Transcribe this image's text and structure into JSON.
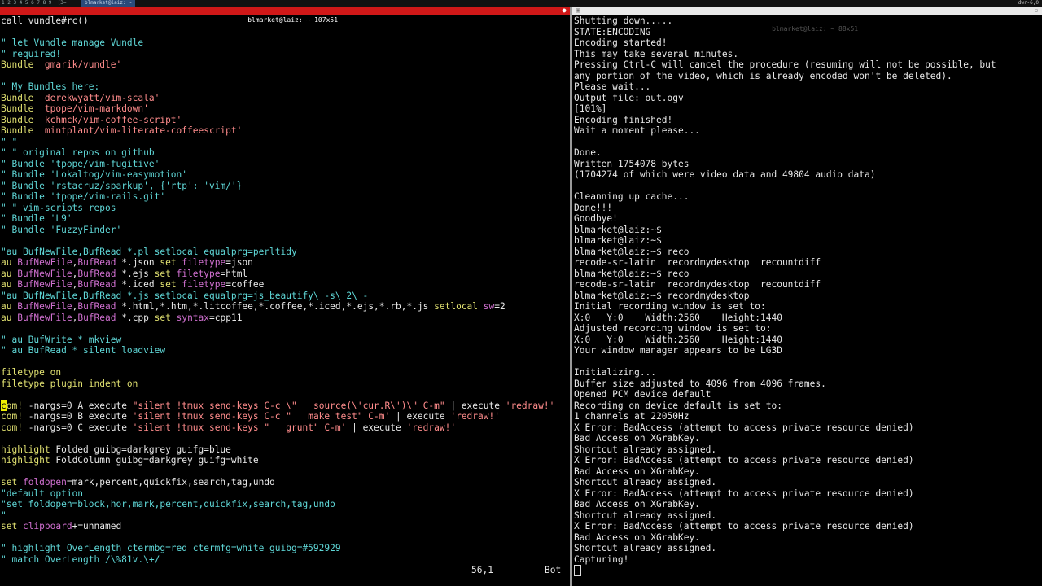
{
  "topbar": {
    "workspaces": "1 2 3 4 5 6 7 8 9  [3=",
    "task": "blmarket@laiz: ~",
    "clock": "dwr-6,0"
  },
  "vim_pane": {
    "title": "blmarket@laiz: ~ 107x51",
    "lines": [
      [
        [
          "w",
          "call vundle#rc()"
        ]
      ],
      [
        [
          "w",
          ""
        ]
      ],
      [
        [
          "c",
          "\" let Vundle manage Vundle"
        ]
      ],
      [
        [
          "c",
          "\" required!"
        ]
      ],
      [
        [
          "y",
          "Bundle "
        ],
        [
          "s",
          "'gmarik/vundle'"
        ]
      ],
      [
        [
          "w",
          ""
        ]
      ],
      [
        [
          "c",
          "\" My Bundles here:"
        ]
      ],
      [
        [
          "y",
          "Bundle "
        ],
        [
          "s",
          "'derekwyatt/vim-scala'"
        ]
      ],
      [
        [
          "y",
          "Bundle "
        ],
        [
          "s",
          "'tpope/vim-markdown'"
        ]
      ],
      [
        [
          "y",
          "Bundle "
        ],
        [
          "s",
          "'kchmck/vim-coffee-script'"
        ]
      ],
      [
        [
          "y",
          "Bundle "
        ],
        [
          "s",
          "'mintplant/vim-literate-coffeescript'"
        ]
      ],
      [
        [
          "c",
          "\" \""
        ]
      ],
      [
        [
          "c",
          "\" \" original repos on github"
        ]
      ],
      [
        [
          "c",
          "\" Bundle 'tpope/vim-fugitive'"
        ]
      ],
      [
        [
          "c",
          "\" Bundle 'Lokaltog/vim-easymotion'"
        ]
      ],
      [
        [
          "c",
          "\" Bundle 'rstacruz/sparkup', {'rtp': 'vim/'}"
        ]
      ],
      [
        [
          "c",
          "\" Bundle 'tpope/vim-rails.git'"
        ]
      ],
      [
        [
          "c",
          "\" \" vim-scripts repos"
        ]
      ],
      [
        [
          "c",
          "\" Bundle 'L9'"
        ]
      ],
      [
        [
          "c",
          "\" Bundle 'FuzzyFinder'"
        ]
      ],
      [
        [
          "w",
          ""
        ]
      ],
      [
        [
          "c",
          "\"au BufNewFile,BufRead *.pl setlocal equalprg=perltidy"
        ]
      ],
      [
        [
          "y",
          "au "
        ],
        [
          "m",
          "BufNewFile"
        ],
        [
          "w",
          ","
        ],
        [
          "m",
          "BufRead "
        ],
        [
          "w",
          "*.json "
        ],
        [
          "y",
          "set "
        ],
        [
          "m",
          "filetype"
        ],
        [
          "w",
          "=json"
        ]
      ],
      [
        [
          "y",
          "au "
        ],
        [
          "m",
          "BufNewFile"
        ],
        [
          "w",
          ","
        ],
        [
          "m",
          "BufRead "
        ],
        [
          "w",
          "*.ejs "
        ],
        [
          "y",
          "set "
        ],
        [
          "m",
          "filetype"
        ],
        [
          "w",
          "=html"
        ]
      ],
      [
        [
          "y",
          "au "
        ],
        [
          "m",
          "BufNewFile"
        ],
        [
          "w",
          ","
        ],
        [
          "m",
          "BufRead "
        ],
        [
          "w",
          "*.iced "
        ],
        [
          "y",
          "set "
        ],
        [
          "m",
          "filetype"
        ],
        [
          "w",
          "=coffee"
        ]
      ],
      [
        [
          "c",
          "\"au BufNewFile,BufRead *.js setlocal equalprg=js_beautify\\ -s\\ 2\\ -"
        ]
      ],
      [
        [
          "y",
          "au "
        ],
        [
          "m",
          "BufNewFile"
        ],
        [
          "w",
          ","
        ],
        [
          "m",
          "BufRead "
        ],
        [
          "w",
          "*.html,*.htm,*.litcoffee,*.coffee,*.iced,*.ejs,*.rb,*.js "
        ],
        [
          "y",
          "setlocal "
        ],
        [
          "m",
          "sw"
        ],
        [
          "w",
          "=2"
        ]
      ],
      [
        [
          "y",
          "au "
        ],
        [
          "m",
          "BufNewFile"
        ],
        [
          "w",
          ","
        ],
        [
          "m",
          "BufRead "
        ],
        [
          "w",
          "*.cpp "
        ],
        [
          "y",
          "set "
        ],
        [
          "m",
          "syntax"
        ],
        [
          "w",
          "=cpp11"
        ]
      ],
      [
        [
          "w",
          ""
        ]
      ],
      [
        [
          "c",
          "\" au BufWrite * mkview"
        ]
      ],
      [
        [
          "c",
          "\" au BufRead * silent loadview"
        ]
      ],
      [
        [
          "w",
          ""
        ]
      ],
      [
        [
          "y",
          "filetype on"
        ]
      ],
      [
        [
          "y",
          "filetype plugin indent on"
        ]
      ],
      [
        [
          "w",
          ""
        ]
      ],
      [
        [
          "k",
          "c"
        ],
        [
          "y",
          "om! "
        ],
        [
          "w",
          "-nargs=0 A execute "
        ],
        [
          "s",
          "\"silent !tmux send-keys C-c \\\"   source(\\'cur.R\\')\\\" C-m\""
        ],
        [
          "w",
          " | execute "
        ],
        [
          "s",
          "'redraw!'"
        ]
      ],
      [
        [
          "y",
          "com! "
        ],
        [
          "w",
          "-nargs=0 B execute "
        ],
        [
          "s",
          "'silent !tmux send-keys C-c \"   make test\" C-m'"
        ],
        [
          "w",
          " | execute "
        ],
        [
          "s",
          "'redraw!'"
        ]
      ],
      [
        [
          "y",
          "com! "
        ],
        [
          "w",
          "-nargs=0 C execute "
        ],
        [
          "s",
          "'silent !tmux send-keys \"   grunt\" C-m'"
        ],
        [
          "w",
          " | execute "
        ],
        [
          "s",
          "'redraw!'"
        ]
      ],
      [
        [
          "w",
          ""
        ]
      ],
      [
        [
          "y",
          "highlight "
        ],
        [
          "w",
          "Folded guibg=darkgrey guifg=blue"
        ]
      ],
      [
        [
          "y",
          "highlight "
        ],
        [
          "w",
          "FoldColumn guibg=darkgrey guifg=white"
        ]
      ],
      [
        [
          "w",
          ""
        ]
      ],
      [
        [
          "y",
          "set "
        ],
        [
          "m",
          "foldopen"
        ],
        [
          "w",
          "=mark,percent,quickfix,search,tag,undo"
        ]
      ],
      [
        [
          "c",
          "\"default option"
        ]
      ],
      [
        [
          "c",
          "\"set foldopen=block,hor,mark,percent,quickfix,search,tag,undo"
        ]
      ],
      [
        [
          "c",
          "\""
        ]
      ],
      [
        [
          "y",
          "set "
        ],
        [
          "m",
          "clipboard"
        ],
        [
          "w",
          "+=unnamed"
        ]
      ],
      [
        [
          "w",
          ""
        ]
      ],
      [
        [
          "c",
          "\" highlight OverLength ctermbg=red ctermfg=white guibg=#592929"
        ]
      ],
      [
        [
          "c",
          "\" match OverLength /\\%81v.\\+/"
        ]
      ]
    ],
    "status": {
      "position": "56,1",
      "scroll": "Bot"
    }
  },
  "terminal_pane": {
    "title": "blmarket@laiz: ~ 88x51",
    "lines": [
      "Shutting down.....",
      "STATE:ENCODING",
      "Encoding started!",
      "This may take several minutes.",
      "Pressing Ctrl-C will cancel the procedure (resuming will not be possible, but",
      "any portion of the video, which is already encoded won't be deleted).",
      "Please wait...",
      "Output file: out.ogv",
      "[101%]",
      "Encoding finished!",
      "Wait a moment please...",
      "",
      "Done.",
      "Written 1754078 bytes",
      "(1704274 of which were video data and 49804 audio data)",
      "",
      "Cleanning up cache...",
      "Done!!!",
      "Goodbye!",
      "blmarket@laiz:~$",
      "blmarket@laiz:~$",
      "blmarket@laiz:~$ reco",
      "recode-sr-latin  recordmydesktop  recountdiff",
      "blmarket@laiz:~$ reco",
      "recode-sr-latin  recordmydesktop  recountdiff",
      "blmarket@laiz:~$ recordmydesktop",
      "Initial recording window is set to:",
      "X:0   Y:0    Width:2560    Height:1440",
      "Adjusted recording window is set to:",
      "X:0   Y:0    Width:2560    Height:1440",
      "Your window manager appears to be LG3D",
      "",
      "Initializing...",
      "Buffer size adjusted to 4096 from 4096 frames.",
      "Opened PCM device default",
      "Recording on device default is set to:",
      "1 channels at 22050Hz",
      "X Error: BadAccess (attempt to access private resource denied)",
      "Bad Access on XGrabKey.",
      "Shortcut already assigned.",
      "X Error: BadAccess (attempt to access private resource denied)",
      "Bad Access on XGrabKey.",
      "Shortcut already assigned.",
      "X Error: BadAccess (attempt to access private resource denied)",
      "Bad Access on XGrabKey.",
      "Shortcut already assigned.",
      "X Error: BadAccess (attempt to access private resource denied)",
      "Bad Access on XGrabKey.",
      "Shortcut already assigned.",
      "Capturing!"
    ]
  }
}
